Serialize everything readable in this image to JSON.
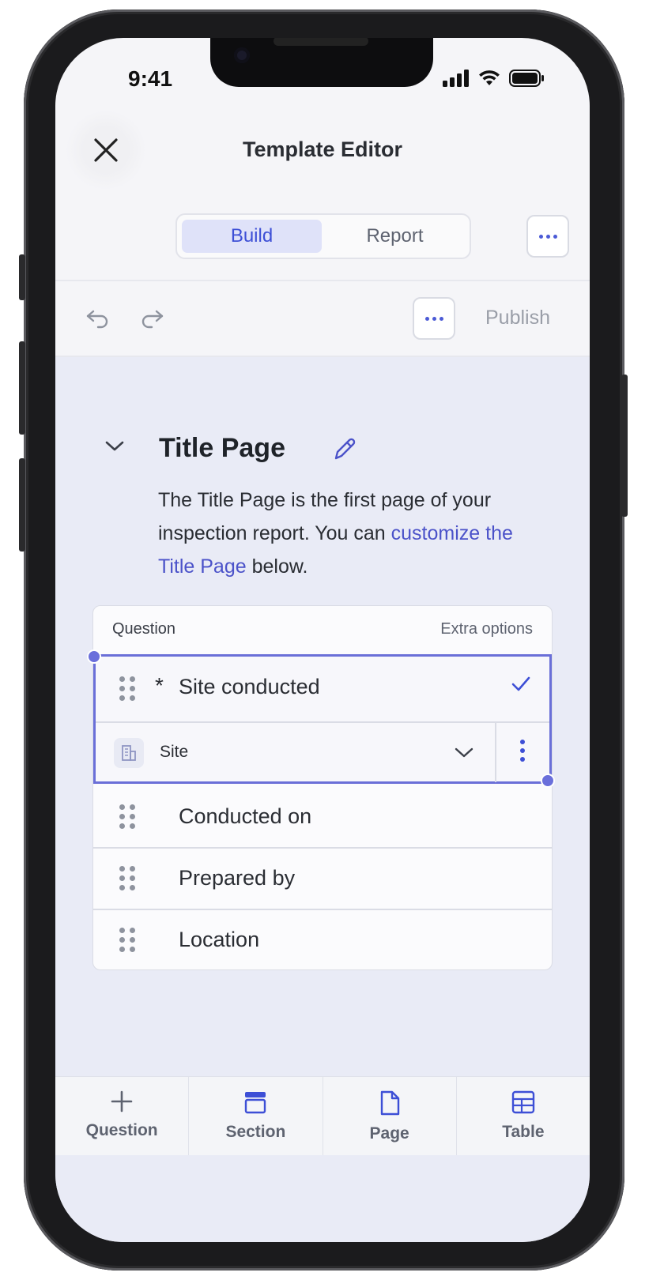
{
  "status_bar": {
    "time": "9:41"
  },
  "header": {
    "title": "Template Editor"
  },
  "tabs": [
    {
      "label": "Build",
      "active": true
    },
    {
      "label": "Report",
      "active": false
    }
  ],
  "toolbar": {
    "publish_label": "Publish"
  },
  "page": {
    "title": "Title Page",
    "description_before_link": "The Title Page is the first page of your inspection report. You can ",
    "description_link": "customize the Title Page",
    "description_after_link": " below."
  },
  "question_card": {
    "header_left": "Question",
    "header_right": "Extra options",
    "selected_question": {
      "required_marker": "*",
      "label": "Site conducted",
      "response_type": "Site"
    },
    "rows": [
      {
        "label": "Conducted on"
      },
      {
        "label": "Prepared by"
      },
      {
        "label": "Location"
      }
    ]
  },
  "bottom_bar": [
    {
      "label": "Question",
      "icon": "plus-icon"
    },
    {
      "label": "Section",
      "icon": "section-icon"
    },
    {
      "label": "Page",
      "icon": "page-icon"
    },
    {
      "label": "Table",
      "icon": "table-icon"
    }
  ],
  "colors": {
    "accent": "#3d4fd6",
    "selection": "#6a6fd8",
    "content_bg": "#e9ebf6",
    "link": "#4b52c9"
  }
}
